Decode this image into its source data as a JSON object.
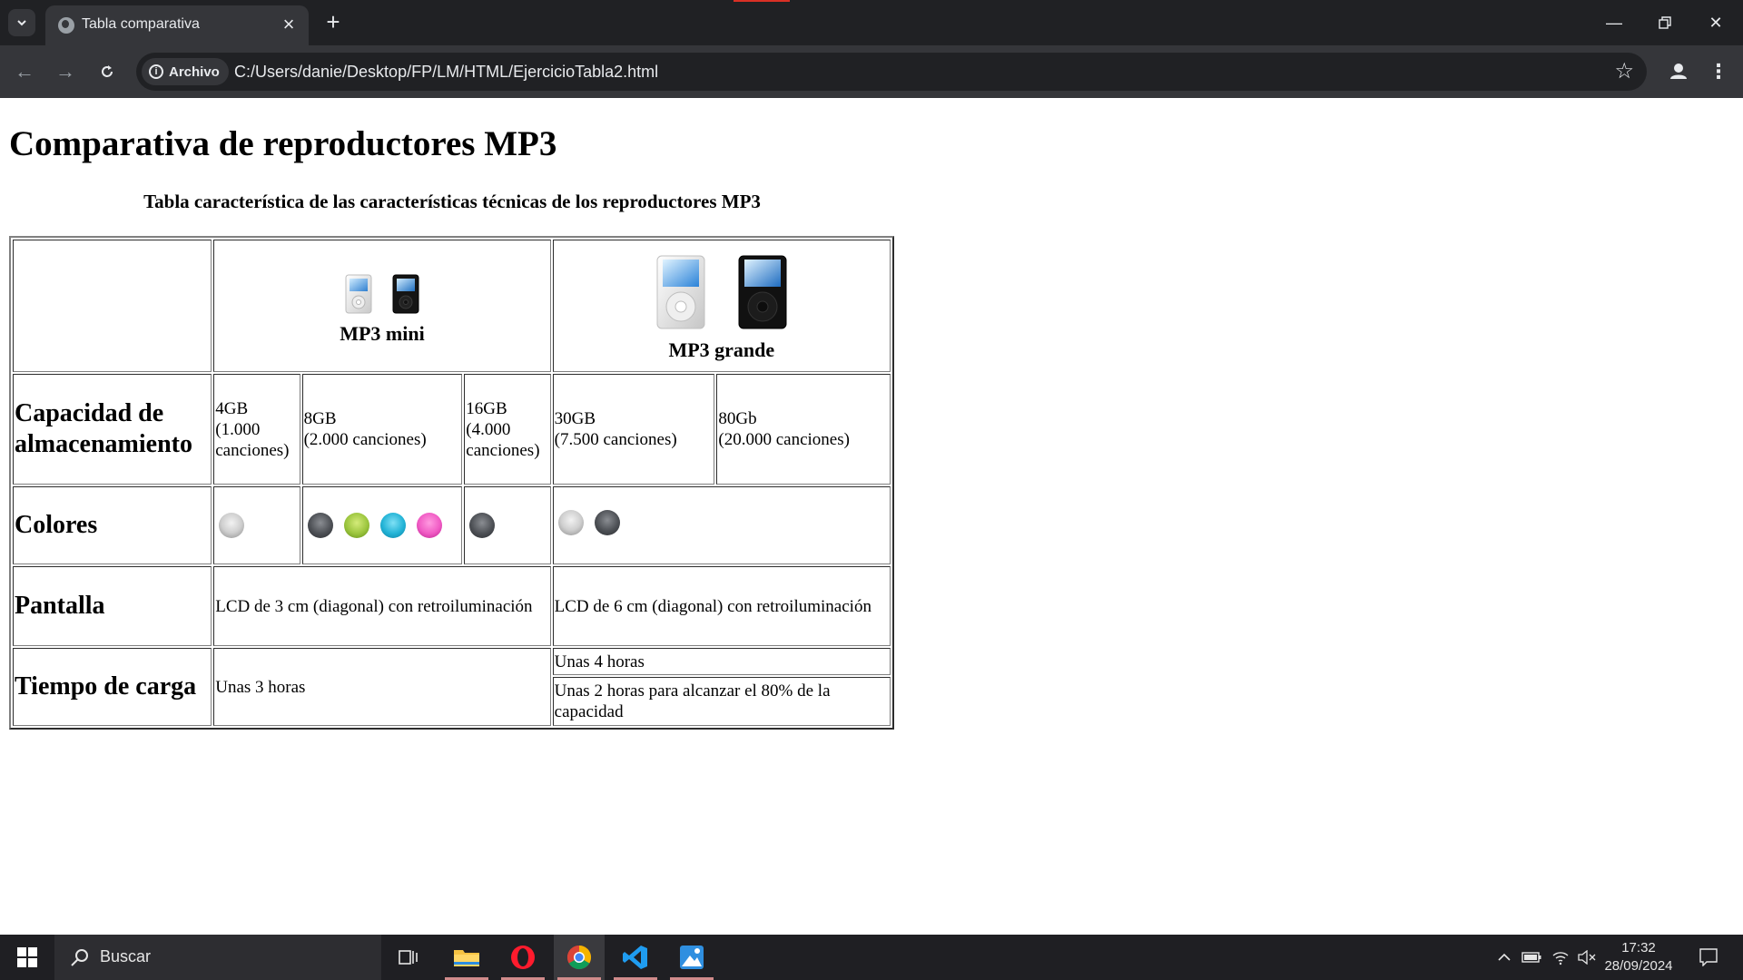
{
  "browser": {
    "tab_title": "Tabla comparativa",
    "site_chip": "Archivo",
    "url": "C:/Users/danie/Desktop/FP/LM/HTML/EjercicioTabla2.html"
  },
  "page": {
    "heading": "Comparativa de reproductores MP3",
    "caption": "Tabla característica de las características técnicas de los reproductores MP3",
    "products": {
      "mini": "MP3 mini",
      "grande": "MP3 grande"
    },
    "rows": {
      "capacidad": {
        "label": "Capacidad de almacenamiento",
        "values": [
          {
            "size": "4GB",
            "songs": "(1.000 canciones)"
          },
          {
            "size": "8GB",
            "songs": "(2.000 canciones)"
          },
          {
            "size": "16GB",
            "songs": "(4.000 canciones)"
          },
          {
            "size": "30GB",
            "songs": "(7.500 canciones)"
          },
          {
            "size": "80Gb",
            "songs": "(20.000 canciones)"
          }
        ]
      },
      "colores": {
        "label": "Colores",
        "swatches": [
          [
            "silver"
          ],
          [
            "black",
            "green",
            "cyan",
            "pink"
          ],
          [
            "black"
          ],
          [
            "silver",
            "black"
          ]
        ]
      },
      "pantalla": {
        "label": "Pantalla",
        "mini": "LCD de 3 cm (diagonal) con retroiluminación",
        "grande": "LCD de 6 cm (diagonal) con retroiluminación"
      },
      "carga": {
        "label": "Tiempo de carga",
        "mini": "Unas 3 horas",
        "grande_1": "Unas 4 horas",
        "grande_2": "Unas 2 horas para alcanzar el 80% de la capacidad"
      }
    }
  },
  "taskbar": {
    "search_placeholder": "Buscar",
    "time": "17:32",
    "date": "28/09/2024"
  },
  "colors": {
    "chrome_dark": "#202124",
    "chrome_mid": "#35363a",
    "taskbar": "#1f1f23"
  }
}
